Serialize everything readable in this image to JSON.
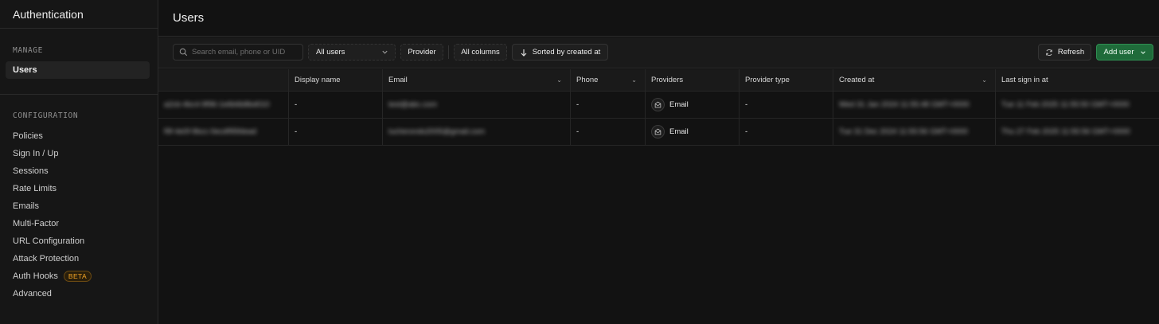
{
  "sidebar": {
    "title": "Authentication",
    "manage_label": "MANAGE",
    "manage_items": [
      {
        "label": "Users",
        "active": true
      }
    ],
    "configuration_label": "CONFIGURATION",
    "configuration_items": [
      {
        "label": "Policies"
      },
      {
        "label": "Sign In / Up"
      },
      {
        "label": "Sessions"
      },
      {
        "label": "Rate Limits"
      },
      {
        "label": "Emails"
      },
      {
        "label": "Multi-Factor"
      },
      {
        "label": "URL Configuration"
      },
      {
        "label": "Attack Protection"
      },
      {
        "label": "Auth Hooks",
        "badge": "BETA"
      },
      {
        "label": "Advanced"
      }
    ]
  },
  "header": {
    "title": "Users"
  },
  "toolbar": {
    "search_placeholder": "Search email, phone or UID",
    "user_filter": "All users",
    "provider_label": "Provider",
    "columns_label": "All columns",
    "sort_label": "Sorted by created at",
    "refresh_label": "Refresh",
    "add_user_label": "Add user"
  },
  "table": {
    "columns": [
      "",
      "Display name",
      "Email",
      "Phone",
      "Providers",
      "Provider type",
      "Created at",
      "Last sign in at"
    ],
    "rows": [
      {
        "uid": "a2cb-4bc4-9f96-1e6b6b8bd010",
        "display_name": "-",
        "email": "test@abc.com",
        "phone": "-",
        "provider": "Email",
        "provider_type": "-",
        "created_at": "Wed 31 Jan 2024 11:55:48 GMT+0000",
        "last_sign_in": "Tue 11 Feb 2025 11:55:50 GMT+0000"
      },
      {
        "uid": "f9f-4e0f-9bcc-0ecdf95fdead",
        "display_name": "-",
        "email": "lucherondo2005@gmail.com",
        "phone": "-",
        "provider": "Email",
        "provider_type": "-",
        "created_at": "Tue 31 Dec 2024 11:55:56 GMT+0000",
        "last_sign_in": "Thu 27 Feb 2025 11:55:56 GMT+0000"
      }
    ]
  },
  "colors": {
    "accent_green": "#1f6b3a",
    "beta_orange": "#f5a524",
    "background": "#121212"
  },
  "icons": {
    "search": "search-icon",
    "sort": "arrow-down-icon",
    "refresh": "refresh-icon",
    "provider": "mail-icon"
  }
}
